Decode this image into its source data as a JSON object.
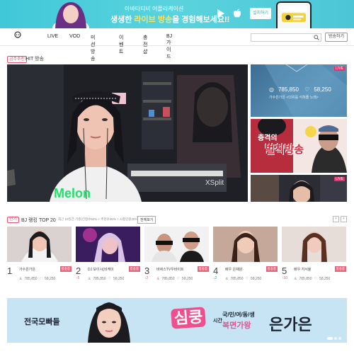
{
  "banner": {
    "line1": "아바타티비 어플리케이션",
    "line2_pre": "생생한 ",
    "line2_hl": "라이브 방송",
    "line2_post": "을 경험해보세요!!",
    "download": "설치하기"
  },
  "header": {
    "logo": "avatatv",
    "nav": [
      "LIVE",
      "VOD",
      "미션방송",
      "이벤트",
      "충전샵",
      "BJ가이드"
    ],
    "search_placeholder": "",
    "start_broadcast": "방송하기"
  },
  "hit": {
    "tag": "금주추천",
    "title": "HIT 방송",
    "main_caption": "Melon",
    "side1": {
      "live": "LIVE",
      "views": "785,850",
      "likes": "58,250",
      "caption": "가수은가은 <더위를 식혀줄 노래>"
    },
    "side2": {
      "title1": "충격의",
      "title2": "벌칙방송"
    }
  },
  "ranking": {
    "tag": "인기",
    "title": "BJ 랭킹 TOP 20",
    "desc": "최근 10일간 기준(신청수50% + 추천수30% + 시청인원20%)",
    "all_button": "전체보기",
    "prev": "‹",
    "next": "›",
    "cards": [
      {
        "rank": "1",
        "delta": "",
        "name": "가수은가은",
        "badge": "방송중",
        "views": "785,850",
        "likes": "58,250"
      },
      {
        "rank": "2",
        "delta": "↑5",
        "name": "DJ 보이시(비케이",
        "badge": "방송중",
        "views": "785,850",
        "likes": "58,250"
      },
      {
        "rank": "3",
        "delta": "↑2",
        "name": "바퀴스TV우바이트",
        "badge": "방송중",
        "views": "785,850",
        "likes": "58,250"
      },
      {
        "rank": "4",
        "delta": "↓2",
        "name": "배우 은채원",
        "badge": "방송중",
        "views": "785,850",
        "likes": "58,250"
      },
      {
        "rank": "5",
        "delta": "↑10",
        "name": "배우 지서율",
        "badge": "방송중",
        "views": "785,850",
        "likes": "58,250"
      }
    ]
  },
  "bottom_banner": {
    "left": "전국모빠들",
    "singkung": "심쿵",
    "sigan": "시간",
    "tags": "국/민/여/동/생",
    "sub": "복면가왕",
    "name": "은가은"
  },
  "colors": {
    "accent": "#e94f6f",
    "banner": "#4cc9d8",
    "pink": "#ef4f8d"
  }
}
